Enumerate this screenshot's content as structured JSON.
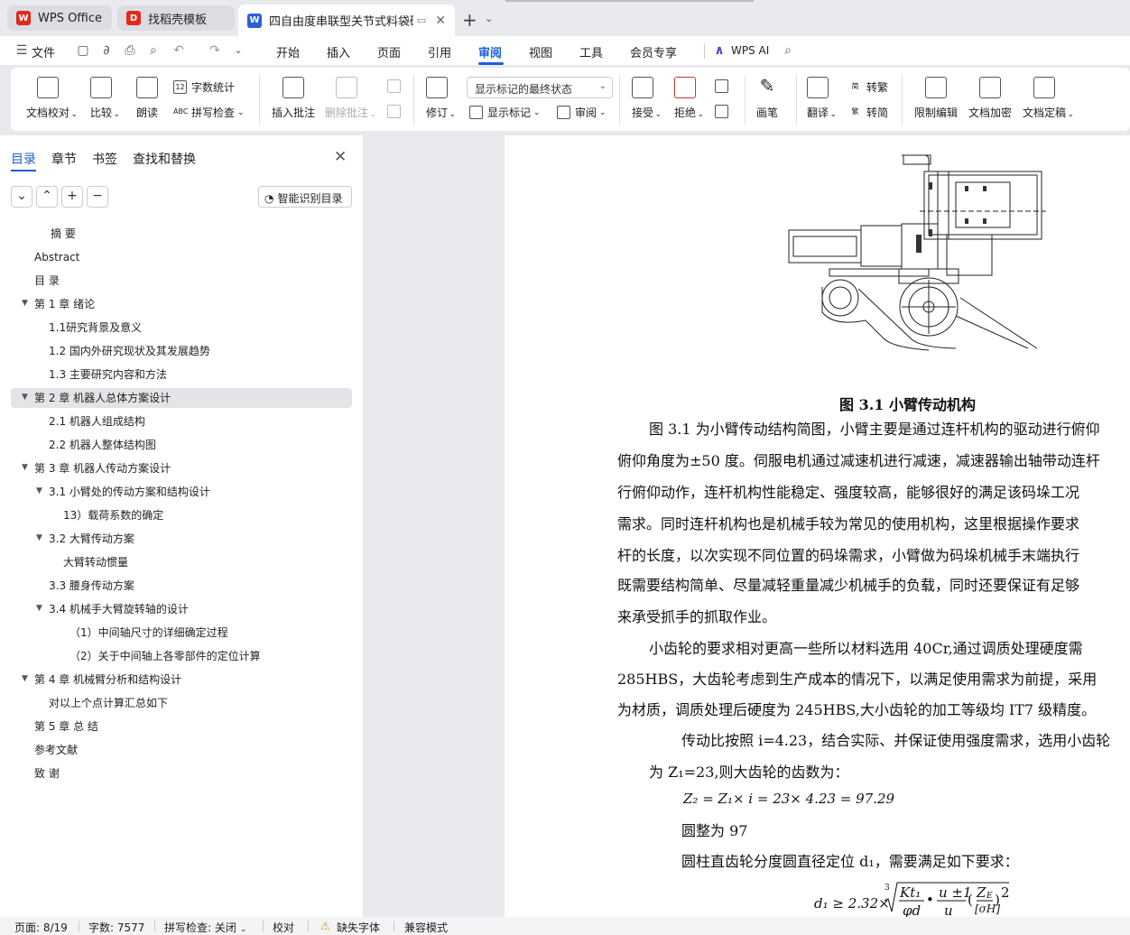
{
  "tabs": [
    {
      "label": "WPS Office",
      "logo": "W",
      "color": "#e2281d"
    },
    {
      "label": "找稻壳模板",
      "logo": "D",
      "color": "#e2281d"
    },
    {
      "label": "四自由度串联型关节式料袋码垛",
      "logo": "W",
      "color": "#2b5fda"
    }
  ],
  "menu": {
    "file": "文件",
    "items": [
      "开始",
      "插入",
      "页面",
      "引用",
      "审阅",
      "视图",
      "工具",
      "会员专享"
    ],
    "active": "审阅",
    "ai": "WPS AI"
  },
  "ribbon": {
    "doc_check": "文档校对",
    "compare": "比较",
    "read_aloud": "朗读",
    "word_count": "字数统计",
    "spell_check": "拼写检查",
    "insert_comment": "插入批注",
    "delete_comment": "删除批注",
    "revise": "修订",
    "markup_state": "显示标记的最终状态",
    "show_markup": "显示标记",
    "review": "审阅",
    "accept": "接受",
    "reject": "拒绝",
    "pen": "画笔",
    "translate": "翻译",
    "to_traditional": "转繁",
    "to_simplified": "转简",
    "restrict_edit": "限制编辑",
    "encrypt": "文档加密",
    "finalize": "文档定稿"
  },
  "sidebar": {
    "tabs": [
      "目录",
      "章节",
      "书签",
      "查找和替换"
    ],
    "smart_toc": "智能识别目录",
    "toc": [
      {
        "label": "摘  要",
        "level": 0,
        "arrow": false
      },
      {
        "label": "Abstract",
        "level": 0,
        "arrow": false
      },
      {
        "label": "目  录",
        "level": 0,
        "arrow": false
      },
      {
        "label": "第 1 章    绪论",
        "level": 0,
        "arrow": true
      },
      {
        "label": "1.1研究背景及意义",
        "level": 1,
        "arrow": false
      },
      {
        "label": "1.2  国内外研究现状及其发展趋势",
        "level": 1,
        "arrow": false
      },
      {
        "label": "1.3  主要研究内容和方法",
        "level": 1,
        "arrow": false
      },
      {
        "label": "第 2 章    机器人总体方案设计",
        "level": 0,
        "arrow": true,
        "highlight": true
      },
      {
        "label": "2.1 机器人组成结构",
        "level": 1,
        "arrow": false
      },
      {
        "label": "2.2 机器人整体结构图",
        "level": 1,
        "arrow": false
      },
      {
        "label": "第 3 章  机器人传动方案设计",
        "level": 0,
        "arrow": true
      },
      {
        "label": "3.1 小臂处的传动方案和结构设计",
        "level": 1,
        "arrow": true
      },
      {
        "label": "13）载荷系数的确定",
        "level": 2,
        "arrow": false
      },
      {
        "label": "3.2 大臂传动方案",
        "level": 1,
        "arrow": true
      },
      {
        "label": "大臂转动惯量",
        "level": 2,
        "arrow": false
      },
      {
        "label": "3.3 腰身传动方案",
        "level": 1,
        "arrow": false
      },
      {
        "label": "3.4 机械手大臂旋转轴的设计",
        "level": 1,
        "arrow": true
      },
      {
        "label": "（1）中间轴尺寸的详细确定过程",
        "level": 3,
        "arrow": false
      },
      {
        "label": "（2）关于中间轴上各零部件的定位计算",
        "level": 3,
        "arrow": false
      },
      {
        "label": "第 4 章  机械臂分析和结构设计",
        "level": 0,
        "arrow": true
      },
      {
        "label": "对以上个点计算汇总如下",
        "level": 1,
        "arrow": false
      },
      {
        "label": "第 5 章  总  结",
        "level": 0,
        "arrow": false
      },
      {
        "label": "参考文献",
        "level": 0,
        "arrow": false
      },
      {
        "label": "致  谢",
        "level": 0,
        "arrow": false
      }
    ]
  },
  "document": {
    "caption": "图 3.1    小臂传动机构",
    "lines": [
      "图 3.1 为小臂传动结构简图，小臂主要是通过连杆机构的驱动进行俯仰",
      "俯仰角度为±50 度。伺服电机通过减速机进行减速，减速器输出轴带动连杆",
      "行俯仰动作，连杆机构性能稳定、强度较高，能够很好的满足该码垛工况",
      "需求。同时连杆机构也是机械手较为常见的使用机构，这里根据操作要求",
      "杆的长度，以次实现不同位置的码垛需求，小臂做为码垛机械手末端执行",
      "既需要结构简单、尽量减轻重量减少机械手的负载，同时还要保证有足够",
      "来承受抓手的抓取作业。",
      "小齿轮的要求相对更高一些所以材料选用 40Cr,通过调质处理硬度需",
      "285HBS，大齿轮考虑到生产成本的情况下，以满足使用需求为前提，采用",
      "为材质，调质处理后硬度为 245HBS,大小齿轮的加工等级均 IT7 级精度。",
      "传动比按照 i=4.23，结合实际、并保证使用强度需求，选用小齿轮",
      "为 Z₁=23,则大齿轮的齿数为：",
      "圆整为 97",
      "圆柱直齿轮分度圆直径定位 d₁，需要满足如下要求："
    ],
    "formula1": "Z₂ = Z₁× i = 23× 4.23 = 97.29",
    "formula2_lhs": "d₁ ≥ 2.32×",
    "formula2_frac1": "Kt₁",
    "formula2_frac1_den": "φd",
    "formula2_frac2": "u ±1",
    "formula2_frac2_den": "u",
    "formula2_frac3": "Z",
    "formula2_frac3_sub": "E",
    "formula2_frac3_den": "[σH]",
    "formula2_exp": "2",
    "formula2_root": "3"
  },
  "status": {
    "page": "页面: 8/19",
    "words": "字数: 7577",
    "spell": "拼写检查: 关闭",
    "proof": "校对",
    "missing_font": "缺失字体",
    "compat": "兼容模式"
  }
}
